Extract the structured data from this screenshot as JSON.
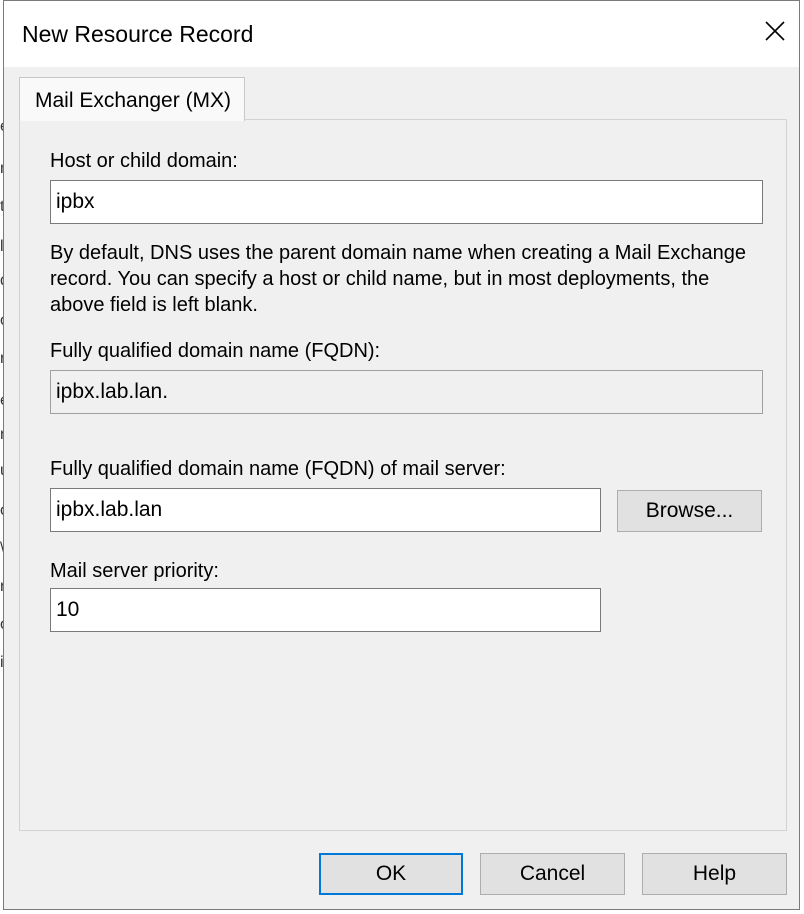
{
  "dialog": {
    "title": "New Resource Record",
    "tab_label": "Mail Exchanger (MX)"
  },
  "form": {
    "host_label": "Host or child domain:",
    "host_value": "ipbx",
    "description": "By default, DNS uses the parent domain name when creating a Mail Exchange record. You can specify a host or child name, but in most deployments, the above field is left blank.",
    "fqdn_label": "Fully qualified domain name (FQDN):",
    "fqdn_value": "ipbx.lab.lan.",
    "mail_server_label": "Fully qualified domain name (FQDN) of mail server:",
    "mail_server_value": "ipbx.lab.lan",
    "browse_label": "Browse...",
    "priority_label": "Mail server priority:",
    "priority_value": "10"
  },
  "buttons": {
    "ok": "OK",
    "cancel": "Cancel",
    "help": "Help"
  },
  "icons": {
    "close": "close-icon"
  },
  "colors": {
    "accent": "#0078d7",
    "dialog_bg": "#f0f0f0"
  }
}
